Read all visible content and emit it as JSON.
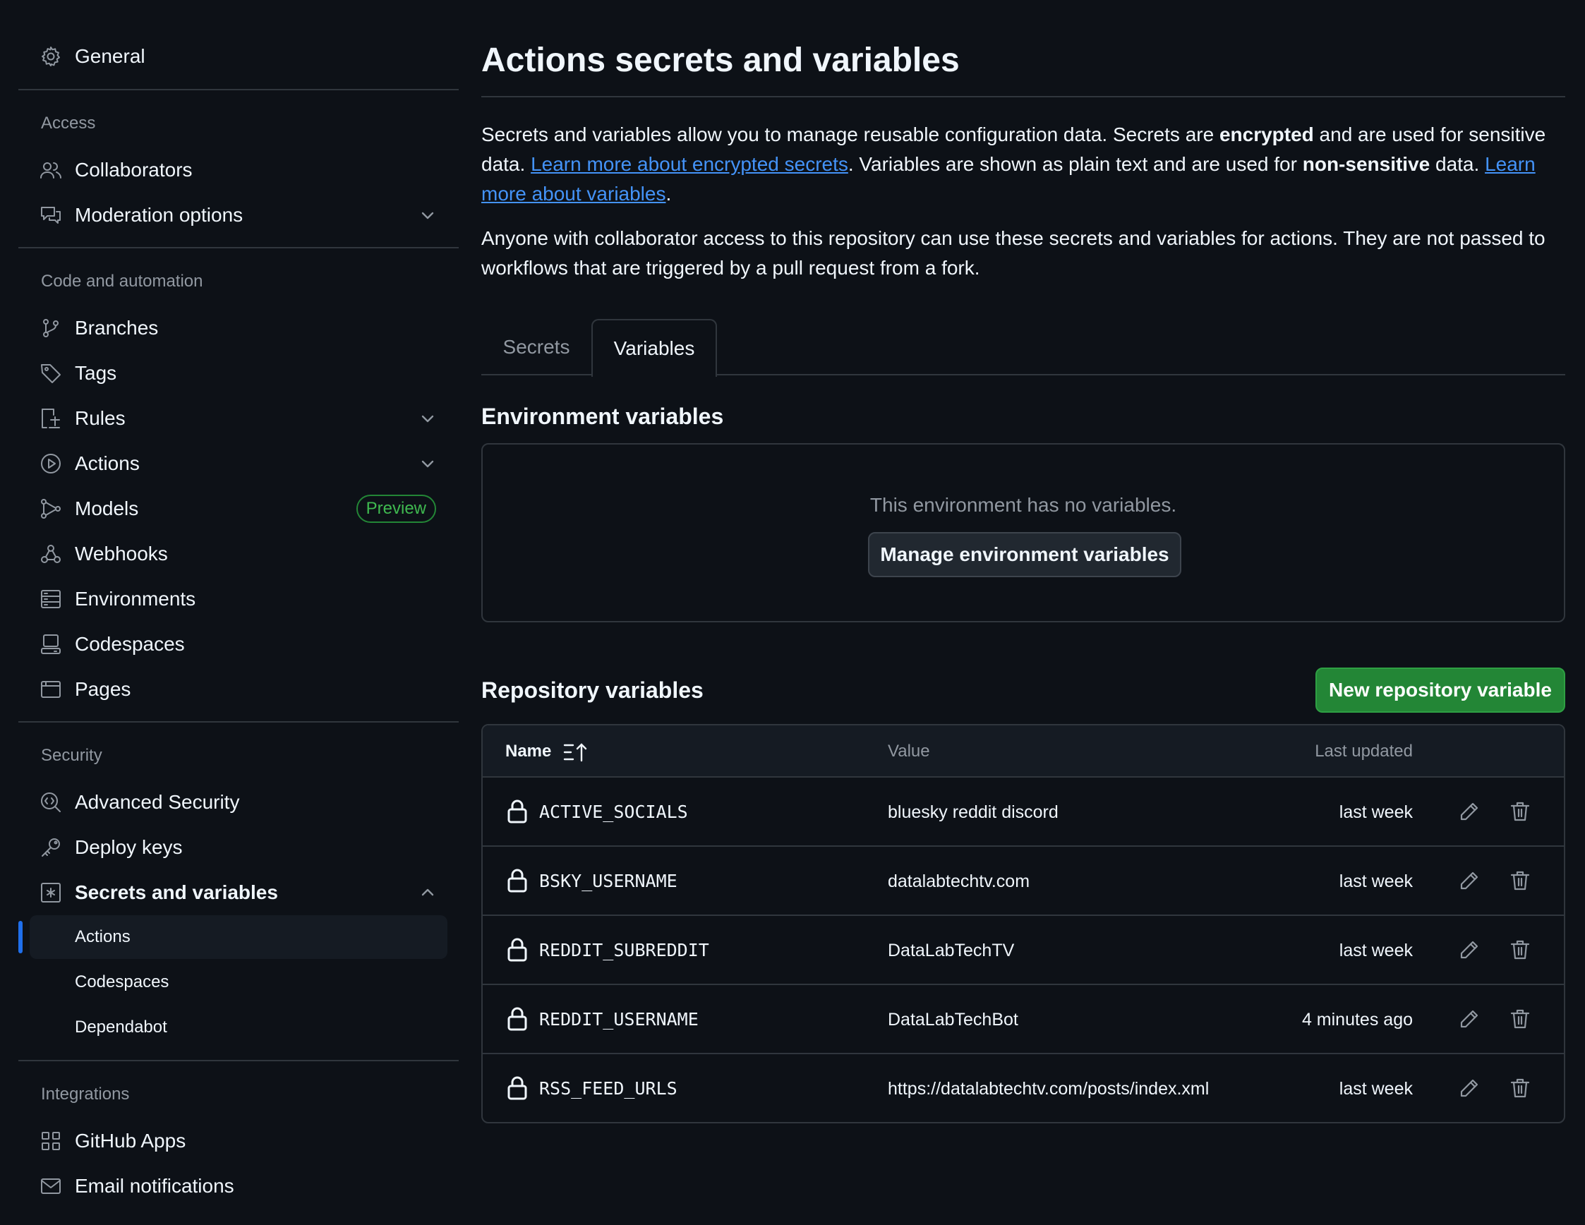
{
  "sidebar": {
    "general": {
      "label": "General",
      "icon": "gear-icon"
    },
    "sections": {
      "access": "Access",
      "code_automation": "Code and automation",
      "security": "Security",
      "integrations": "Integrations"
    },
    "access_items": [
      {
        "label": "Collaborators",
        "icon": "people-icon"
      },
      {
        "label": "Moderation options",
        "icon": "comment-discussion-icon"
      }
    ],
    "code_items": [
      {
        "label": "Branches",
        "icon": "branch-icon"
      },
      {
        "label": "Tags",
        "icon": "tag-icon"
      },
      {
        "label": "Rules",
        "icon": "rules-icon"
      },
      {
        "label": "Actions",
        "icon": "play-icon"
      },
      {
        "label": "Models",
        "icon": "models-icon",
        "badge": "Preview"
      },
      {
        "label": "Webhooks",
        "icon": "webhook-icon"
      },
      {
        "label": "Environments",
        "icon": "server-icon"
      },
      {
        "label": "Codespaces",
        "icon": "codespaces-icon"
      },
      {
        "label": "Pages",
        "icon": "browser-icon"
      }
    ],
    "security_items": [
      {
        "label": "Advanced Security",
        "icon": "codescan-icon"
      },
      {
        "label": "Deploy keys",
        "icon": "key-icon"
      },
      {
        "label": "Secrets and variables",
        "icon": "asterisk-icon"
      }
    ],
    "secrets_sub": [
      "Actions",
      "Codespaces",
      "Dependabot"
    ],
    "integration_items": [
      {
        "label": "GitHub Apps",
        "icon": "apps-icon"
      },
      {
        "label": "Email notifications",
        "icon": "mail-icon"
      }
    ]
  },
  "main": {
    "title": "Actions secrets and variables",
    "intro": {
      "p1_a": "Secrets and variables allow you to manage reusable configuration data. Secrets are ",
      "p1_b": "encrypted",
      "p1_c": " and are used for sensitive data. ",
      "p1_link1": "Learn more about encrypted secrets",
      "p1_d": ". Variables are shown as plain text and are used for ",
      "p1_e": "non-sensitive",
      "p1_f": " data. ",
      "p1_link2": "Learn more about variables",
      "p1_g": ".",
      "p2": "Anyone with collaborator access to this repository can use these secrets and variables for actions. They are not passed to workflows that are triggered by a pull request from a fork."
    },
    "tabs": {
      "secrets": "Secrets",
      "variables": "Variables"
    },
    "env": {
      "heading": "Environment variables",
      "empty": "This environment has no variables.",
      "manage_button": "Manage environment variables"
    },
    "repo": {
      "heading": "Repository variables",
      "new_button": "New repository variable",
      "columns": {
        "name": "Name",
        "value": "Value",
        "updated": "Last updated"
      },
      "rows": [
        {
          "name": "ACTIVE_SOCIALS",
          "value": "bluesky reddit discord",
          "updated": "last week"
        },
        {
          "name": "BSKY_USERNAME",
          "value": "datalabtechtv.com",
          "updated": "last week"
        },
        {
          "name": "REDDIT_SUBREDDIT",
          "value": "DataLabTechTV",
          "updated": "last week"
        },
        {
          "name": "REDDIT_USERNAME",
          "value": "DataLabTechBot",
          "updated": "4 minutes ago"
        },
        {
          "name": "RSS_FEED_URLS",
          "value": "https://datalabtechtv.com/posts/index.xml",
          "updated": "last week"
        }
      ]
    }
  },
  "colors": {
    "background": "#0d1117",
    "border": "#30363d",
    "muted": "#9198a1",
    "link": "#4493f8",
    "primary_button": "#238636",
    "active_indicator": "#1f6feb"
  }
}
